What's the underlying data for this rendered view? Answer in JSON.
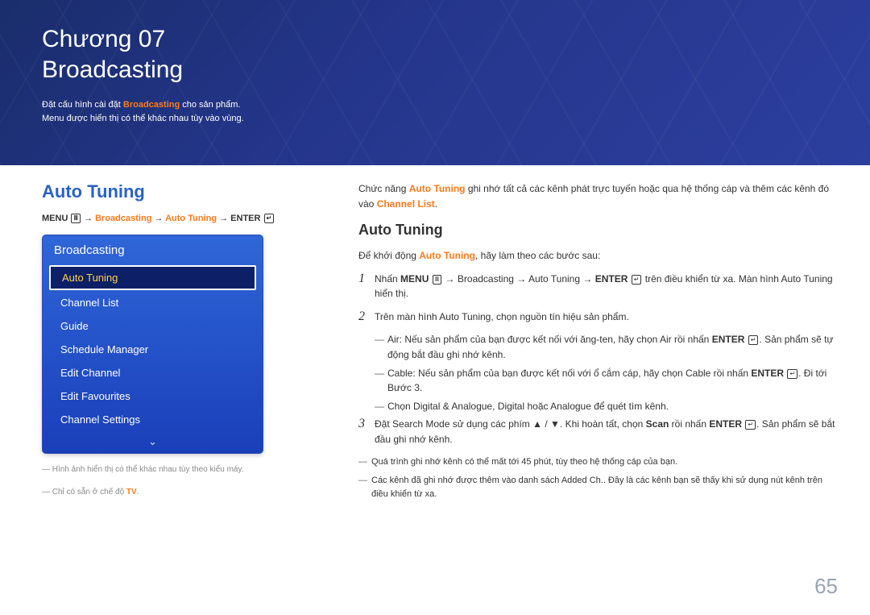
{
  "header": {
    "chapter": "Chương 07",
    "title": "Broadcasting",
    "intro_prefix": "Đặt cấu hình cài đặt ",
    "intro_hl": "Broadcasting",
    "intro_suffix": " cho sản phẩm.",
    "intro_line2": "Menu được hiển thị có thể khác nhau tùy vào vùng."
  },
  "left": {
    "heading": "Auto Tuning",
    "path_menu": "MENU ",
    "path_arrow": " → ",
    "path_broadcasting": "Broadcasting",
    "path_autotuning": "Auto Tuning",
    "path_enter": "ENTER ",
    "menu_icon": "Ⅲ",
    "enter_icon": "↵",
    "menu": {
      "title": "Broadcasting",
      "items": [
        "Auto Tuning",
        "Channel List",
        "Guide",
        "Schedule Manager",
        "Edit Channel",
        "Edit Favourites",
        "Channel Settings"
      ],
      "chevron": "⌄"
    },
    "foot1_dash": "―",
    "foot1": " Hình ảnh hiển thị có thể khác nhau tùy theo kiểu máy.",
    "foot2_pre": "― Chỉ có sẵn ở chế độ ",
    "foot2_hl": "TV",
    "foot2_suf": "."
  },
  "right": {
    "intro_pre": "Chức năng ",
    "intro_hl1": "Auto Tuning",
    "intro_mid": " ghi nhớ tất cả các kênh phát trực tuyến hoặc qua hệ thống cáp và thêm các kênh đó vào ",
    "intro_hl2": "Channel List",
    "intro_suf": ".",
    "subhead": "Auto Tuning",
    "p2_pre": "Để khởi động ",
    "p2_hl": "Auto Tuning",
    "p2_suf": ", hãy làm theo các bước sau:",
    "step1_num": "1",
    "step1_pre": "Nhấn ",
    "step1_menu": "MENU ",
    "step1_arrow": " → ",
    "step1_broadcasting": "Broadcasting",
    "step1_autotuning": "Auto Tuning",
    "step1_enter": "ENTER ",
    "step1_mid": " trên điều khiển từ xa. Màn hình ",
    "step1_hl": "Auto Tuning",
    "step1_suf": " hiển thị.",
    "step2_num": "2",
    "step2_pre": "Trên màn hình ",
    "step2_hl": "Auto Tuning",
    "step2_suf": ", chọn nguồn tín hiệu sản phẩm.",
    "s2a_hl": "Air",
    "s2a_pre": ": Nếu sản phẩm của bạn được kết nối với ăng-ten, hãy chọn ",
    "s2a_hl2": "Air",
    "s2a_mid": " rồi nhấn ",
    "s2a_enter": "ENTER ",
    "s2a_suf": ". Sản phẩm sẽ tự động bắt đầu ghi nhớ kênh.",
    "s2b_hl": "Cable",
    "s2b_pre": ": Nếu sản phẩm của bạn được kết nối với ổ cắm cáp, hãy chọn ",
    "s2b_hl2": "Cable",
    "s2b_mid": " rồi nhấn ",
    "s2b_enter": "ENTER ",
    "s2b_suf": ". Đi tới Bước 3.",
    "s2c_pre": "Chọn ",
    "s2c_hl1": "Digital & Analogue",
    "s2c_sep1": ", ",
    "s2c_hl2": "Digital",
    "s2c_sep2": " hoặc ",
    "s2c_hl3": "Analogue",
    "s2c_suf": " để quét tìm kênh.",
    "step3_num": "3",
    "step3_pre": "Đặt ",
    "step3_hl": "Search Mode",
    "step3_mid": " sử dụng các phím ▲ / ▼. Khi hoàn tất, chọn ",
    "step3_scan": "Scan",
    "step3_mid2": " rồi nhấn ",
    "step3_enter": "ENTER ",
    "step3_suf": ". Sản phẩm sẽ bắt đầu ghi nhớ kênh.",
    "note1": "Quá trình ghi nhớ kênh có thể mất tới 45 phút, tùy theo hệ thống cáp của bạn.",
    "note2_pre": "Các kênh đã ghi nhớ được thêm vào danh sách ",
    "note2_hl": "Added Ch.",
    "note2_suf": ". Đây là các kênh bạn sẽ thấy khi sử dụng nút kênh trên điều khiển từ xa."
  },
  "page_number": "65"
}
